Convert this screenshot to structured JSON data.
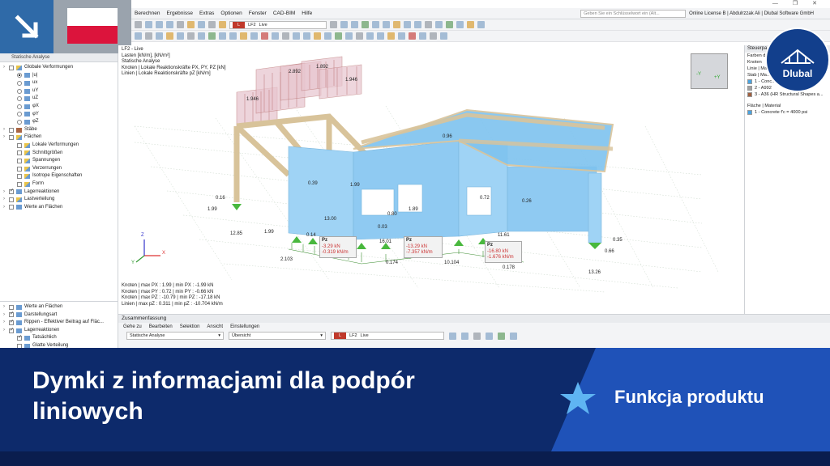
{
  "window": {
    "minimize": "—",
    "restore": "❐",
    "close": "✕"
  },
  "menu": {
    "items": [
      "Berechnen",
      "Ergebnisse",
      "Extras",
      "Optionen",
      "Fenster",
      "CAD-BIM",
      "Hilfe"
    ],
    "search_placeholder": "Geben Sie ein Schlüsselwort ein (Alt...",
    "license": "Online License B | Abdulrzzak Ali | Dlubal Software GmbH"
  },
  "toolbar": {
    "loadcase_id": "L",
    "loadcase_code": "LF2",
    "loadcase_name": "Live",
    "loadcase_id2": "L",
    "loadcase_code2": "LF2",
    "loadcase_name2": "Live"
  },
  "navigator": {
    "header": "Statische Analyse",
    "items": [
      {
        "label": "Globale Verformungen",
        "type": "cb",
        "on": false,
        "indent": 0,
        "icon": "y"
      },
      {
        "label": "|u|",
        "type": "rb",
        "on": true,
        "indent": 1,
        "icon": "b"
      },
      {
        "label": "ux",
        "type": "rb",
        "on": false,
        "indent": 1,
        "icon": "b"
      },
      {
        "label": "uY",
        "type": "rb",
        "on": false,
        "indent": 1,
        "icon": "b"
      },
      {
        "label": "uZ",
        "type": "rb",
        "on": false,
        "indent": 1,
        "icon": "b"
      },
      {
        "label": "φX",
        "type": "rb",
        "on": false,
        "indent": 1,
        "icon": "b"
      },
      {
        "label": "φY",
        "type": "rb",
        "on": false,
        "indent": 1,
        "icon": "b"
      },
      {
        "label": "φZ",
        "type": "rb",
        "on": false,
        "indent": 1,
        "icon": "b"
      },
      {
        "label": "Stäbe",
        "type": "cb",
        "on": false,
        "indent": 0,
        "icon": "r"
      },
      {
        "label": "Flächen",
        "type": "cb",
        "on": false,
        "indent": 0,
        "icon": "y"
      },
      {
        "label": "Lokale Verformungen",
        "type": "cb",
        "on": false,
        "indent": 1,
        "icon": "y"
      },
      {
        "label": "Schnittgrößen",
        "type": "cb",
        "on": false,
        "indent": 1,
        "icon": "y"
      },
      {
        "label": "Spannungen",
        "type": "cb",
        "on": false,
        "indent": 1,
        "icon": "y"
      },
      {
        "label": "Verzerrungen",
        "type": "cb",
        "on": false,
        "indent": 1,
        "icon": "y"
      },
      {
        "label": "Isotrope Eigenschaften",
        "type": "cb",
        "on": false,
        "indent": 1,
        "icon": "y"
      },
      {
        "label": "Form",
        "type": "cb",
        "on": false,
        "indent": 1,
        "icon": "y"
      },
      {
        "label": "Lagerreaktionen",
        "type": "cb",
        "on": true,
        "indent": 0,
        "icon": "g"
      },
      {
        "label": "Lastverteilung",
        "type": "cb",
        "on": false,
        "indent": 0,
        "icon": "y"
      },
      {
        "label": "Werte an Flächen",
        "type": "cb",
        "on": false,
        "indent": 0,
        "icon": "b"
      }
    ],
    "bottom_items": [
      {
        "label": "Werte an Flächen",
        "on": false,
        "indent": 0
      },
      {
        "label": "Darstellungsart",
        "on": true,
        "indent": 0
      },
      {
        "label": "Rippen - Effektiver Beitrag auf Fläc...",
        "on": true,
        "indent": 0
      },
      {
        "label": "Lagerreaktionen",
        "on": true,
        "indent": 0
      },
      {
        "label": "Tatsächlich",
        "on": true,
        "indent": 1
      },
      {
        "label": "Glatte Verteilung",
        "on": false,
        "indent": 1
      }
    ]
  },
  "viewport": {
    "info_lines": [
      "LF2 - Live",
      "Lasten [kN/m], [kN/m²]",
      "Statische Analyse",
      "Knoten | Lokale Reaktionskräfte PX, PY, PZ [kN]",
      "Linien | Lokale Reaktionskräfte pZ [kN/m]"
    ],
    "summary_lines": [
      "Knoten | max PX : 1.99 | min PX : -1.99 kN",
      "Knoten | max PY : 0.72 | min PY : -0.66 kN",
      "Knoten | max PZ : -10.79 | min PZ : -17.18 kN",
      "Linien | max pZ : 0.311 | min pZ : -10.704 kN/m"
    ],
    "load_values": [
      "1.946",
      "2.892",
      "1.892",
      "1.946"
    ],
    "result_labels": [
      {
        "t": "0.96",
        "k": "a"
      },
      {
        "t": "0.39",
        "k": "a"
      },
      {
        "t": "1.99",
        "k": "a"
      },
      {
        "t": "13.00",
        "k": "a"
      },
      {
        "t": "0.03",
        "k": "a"
      },
      {
        "t": "0.72",
        "k": "a"
      },
      {
        "t": "0.26",
        "k": "a"
      },
      {
        "t": "0.14",
        "k": "a"
      },
      {
        "t": "16.01",
        "k": "a"
      },
      {
        "t": "11.61",
        "k": "a"
      },
      {
        "t": "0.35",
        "k": "a"
      },
      {
        "t": "0.66",
        "k": "a"
      },
      {
        "t": "13.26",
        "k": "a"
      },
      {
        "t": "12.85",
        "k": "a"
      },
      {
        "t": "1.99",
        "k": "a"
      },
      {
        "t": "0.16",
        "k": "a"
      },
      {
        "t": "1.99",
        "k": "a"
      },
      {
        "t": "2.103",
        "k": "a"
      },
      {
        "t": "0.174",
        "k": "a"
      },
      {
        "t": "10.104",
        "k": "a"
      },
      {
        "t": "0.178",
        "k": "a"
      },
      {
        "t": "1.89",
        "k": "a"
      },
      {
        "t": "0.80",
        "k": "a"
      }
    ],
    "tooltips": [
      {
        "title": "Pz",
        "line1": "-3.29  kN",
        "line2": "-0.319 kN/m"
      },
      {
        "title": "Pz",
        "line1": "-13.29 kN",
        "line2": "-7.357 kN/m"
      },
      {
        "title": "Pz",
        "line1": "-16.80 kN",
        "line2": "-1.676 kN/m"
      }
    ],
    "axes": {
      "x": "X",
      "y": "Y",
      "z": "Z"
    },
    "cube": {
      "left": "-Y",
      "right": "+Y"
    }
  },
  "rightpanel": {
    "header": "Steuerpa...",
    "sub": "Farben d...",
    "rows1": [
      "Knoten",
      "Linie | Ma...",
      "Stab | Ma..."
    ],
    "materials": [
      {
        "label": "1 - Conc...",
        "color": "#4aa3e0"
      },
      {
        "label": "2 - A992",
        "color": "#a0a0a0"
      },
      {
        "label": "3 - A36 (HR Structural Shapes a...",
        "color": "#a06040"
      }
    ],
    "surface_header": "Fläche | Material",
    "surface_item": {
      "label": "1 - Concrete f'c = 4000 psi",
      "color": "#4aa3e0"
    }
  },
  "summary": {
    "title": "Zusammenfassung",
    "menu": [
      "Gehe zu",
      "Bearbeiten",
      "Selektion",
      "Ansicht",
      "Einstellungen"
    ],
    "analysis": "Statische Analyse",
    "overview": "Übersicht"
  },
  "banner": {
    "title": "Dymki z informacjami dla podpór liniowych",
    "feature": "Funkcja produktu",
    "logo": "Dlubal"
  },
  "colors": {
    "banner_dark": "#0d2a6b",
    "banner_light": "#1f52b8",
    "structure_blue": "#87c9f3",
    "beam": "#d8c39a",
    "support_green": "#49b83e"
  }
}
